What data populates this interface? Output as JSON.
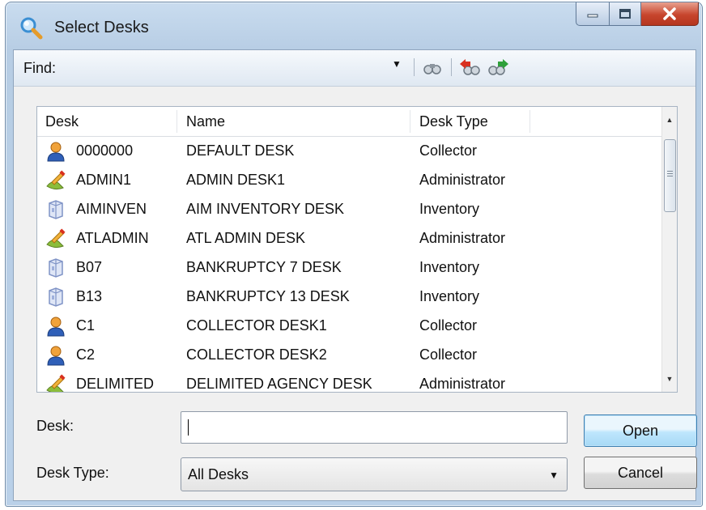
{
  "window": {
    "title": "Select Desks"
  },
  "findbar": {
    "label": "Find:",
    "value": ""
  },
  "list": {
    "columns": [
      "Desk",
      "Name",
      "Desk Type"
    ],
    "rows": [
      {
        "desk": "0000000",
        "name": "DEFAULT DESK",
        "type": "Collector",
        "icon": "collector-icon"
      },
      {
        "desk": "ADMIN1",
        "name": "ADMIN DESK1",
        "type": "Administrator",
        "icon": "administrator-icon"
      },
      {
        "desk": "AIMINVEN",
        "name": "AIM INVENTORY DESK",
        "type": "Inventory",
        "icon": "inventory-icon"
      },
      {
        "desk": "ATLADMIN",
        "name": "ATL ADMIN DESK",
        "type": "Administrator",
        "icon": "administrator-icon"
      },
      {
        "desk": "B07",
        "name": "BANKRUPTCY 7 DESK",
        "type": "Inventory",
        "icon": "inventory-icon"
      },
      {
        "desk": "B13",
        "name": "BANKRUPTCY 13 DESK",
        "type": "Inventory",
        "icon": "inventory-icon"
      },
      {
        "desk": "C1",
        "name": "COLLECTOR DESK1",
        "type": "Collector",
        "icon": "collector-icon"
      },
      {
        "desk": "C2",
        "name": "COLLECTOR DESK2",
        "type": "Collector",
        "icon": "collector-icon"
      },
      {
        "desk": "DELIMITED",
        "name": "DELIMITED AGENCY DESK",
        "type": "Administrator",
        "icon": "administrator-icon"
      }
    ]
  },
  "form": {
    "desk_label": "Desk:",
    "desk_value": "",
    "desk_type_label": "Desk Type:",
    "desk_type_value": "All Desks"
  },
  "buttons": {
    "open": "Open",
    "cancel": "Cancel"
  }
}
